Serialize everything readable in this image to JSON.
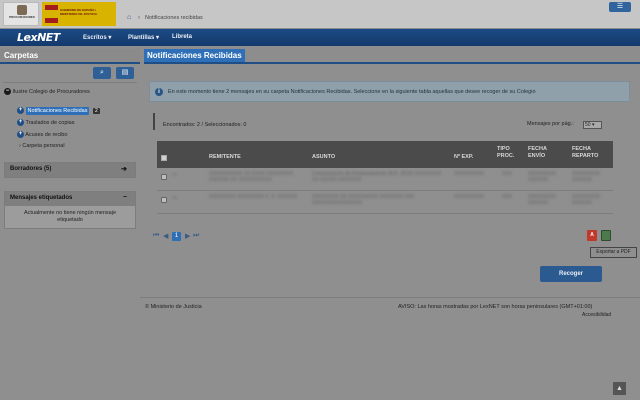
{
  "header": {
    "logo_proc_text": "PROCURADORES",
    "logo_gob_text": "GOBIERNO DE ESPAÑA / MINISTERIO DE JUSTICIA",
    "menu_icon": "☰",
    "home_icon": "⌂",
    "breadcrumb_sep": "›",
    "breadcrumb_current": "Notificaciones recibidas"
  },
  "nav": {
    "brand": "LexNET",
    "items": [
      "Escritos ▾",
      "Plantillas ▾",
      "Libreta"
    ]
  },
  "sidebar": {
    "title": "Carpetas",
    "search_icon": "🔍",
    "folder_icon": "📁",
    "root": "Ilustre Colegio de Procuradores",
    "items": [
      {
        "label": "Notificaciones Recibidas",
        "count": "2"
      },
      {
        "label": "Traslados de copias"
      },
      {
        "label": "Acuses de recibo"
      },
      {
        "label": "Carpeta personal"
      }
    ],
    "borradores": "Borradores (5)",
    "borradores_arrow": "➔",
    "etiquetados_title": "Mensajes etiquetados",
    "etiquetados_toggle": "−",
    "etiquetados_body": "Actualmente no tiene ningún mensaje etiquetado"
  },
  "main": {
    "title": "Notificaciones Recibidas",
    "alert": "En este momento tiene 2 mensajes en su carpeta Notificaciones Recibidas. Seleccione en la siguiente tabla aquellas que desee recoger de su Colegio",
    "found": "Encontrados: 2 / Seleccionados: 0",
    "per_page_label": "Mensajes por pág.:",
    "per_page_value": "50",
    "columns": [
      "REMITENTE",
      "ASUNTO",
      "Nº EXP.",
      "TIPO PROC.",
      "FECHA ENVÍO",
      "FECHA REPARTO"
    ],
    "rows": [
      [
        "XXXXXXXXXX XX XXXX XXXXXXXX XXXXXX XX XXXXXXXXXX",
        "Comunicación de Emplazamiento (A.E. 2015) XXXXXXXX XX XXXXX XXXXXXX",
        "XXXXXXXXX",
        "XXX",
        "XXXXXXXXXX XXXXXX",
        "XXXXXXXXXX XXXXXX"
      ],
      [
        "XXXXXXXX XXXXXXXX X. X. XXXXXX",
        "XXXXXXXX XX XXXXXXXXX XXXXXXX XXX XXXXXXXXXXXXXXX",
        "XXXXXXXXX",
        "XXX",
        "XXXXXXXXXX XXXXXX",
        "XXXXXXXXXX XXXXXX"
      ]
    ],
    "pager_current": "1",
    "export_tooltip": "Exportar a PDF",
    "pdf_icon": "A",
    "recoger": "Recoger"
  },
  "footer": {
    "left": "© Ministerio de Justicia",
    "right": "AVISO: Las horas mostradas por LexNET son horas peninsulares (GMT+01:00)",
    "accesibilidad": "Accesibilidad",
    "scroll_top_icon": "▲"
  }
}
